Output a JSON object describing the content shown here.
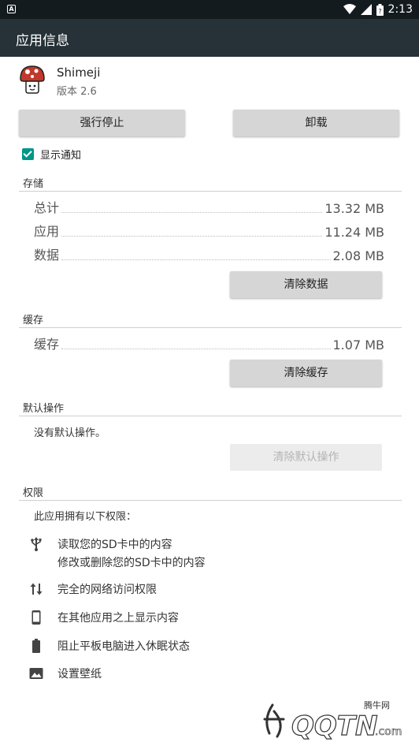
{
  "status_bar": {
    "time": "2:13"
  },
  "app_bar": {
    "title": "应用信息"
  },
  "app": {
    "name": "Shimeji",
    "version": "版本 2.6"
  },
  "buttons": {
    "force_stop": "强行停止",
    "uninstall": "卸载"
  },
  "notifications": {
    "label": "显示通知",
    "checked": true
  },
  "storage": {
    "title": "存储",
    "rows": [
      {
        "label": "总计",
        "value": "13.32 MB"
      },
      {
        "label": "应用",
        "value": "11.24 MB"
      },
      {
        "label": "数据",
        "value": "2.08 MB"
      }
    ],
    "clear_button": "清除数据"
  },
  "cache": {
    "title": "缓存",
    "row": {
      "label": "缓存",
      "value": "1.07 MB"
    },
    "clear_button": "清除缓存"
  },
  "defaults": {
    "title": "默认操作",
    "text": "没有默认操作。",
    "clear_button": "清除默认操作"
  },
  "permissions": {
    "title": "权限",
    "intro": "此应用拥有以下权限：",
    "items": [
      {
        "icon": "usb-icon",
        "lines": [
          "读取您的SD卡中的内容",
          "修改或删除您的SD卡中的内容"
        ]
      },
      {
        "icon": "network-arrows-icon",
        "lines": [
          "完全的网络访问权限"
        ]
      },
      {
        "icon": "phone-icon",
        "lines": [
          "在其他应用之上显示内容"
        ]
      },
      {
        "icon": "battery-icon",
        "lines": [
          "阻止平板电脑进入休眠状态"
        ]
      },
      {
        "icon": "image-icon",
        "lines": [
          "设置壁纸"
        ]
      }
    ]
  },
  "watermark": {
    "site": "腾牛网",
    "logo_text": "QQTN",
    "suffix": ".com"
  },
  "colors": {
    "status_bar": "#141b1f",
    "app_bar": "#263238",
    "accent": "#009688",
    "button": "#d6d6d6"
  }
}
